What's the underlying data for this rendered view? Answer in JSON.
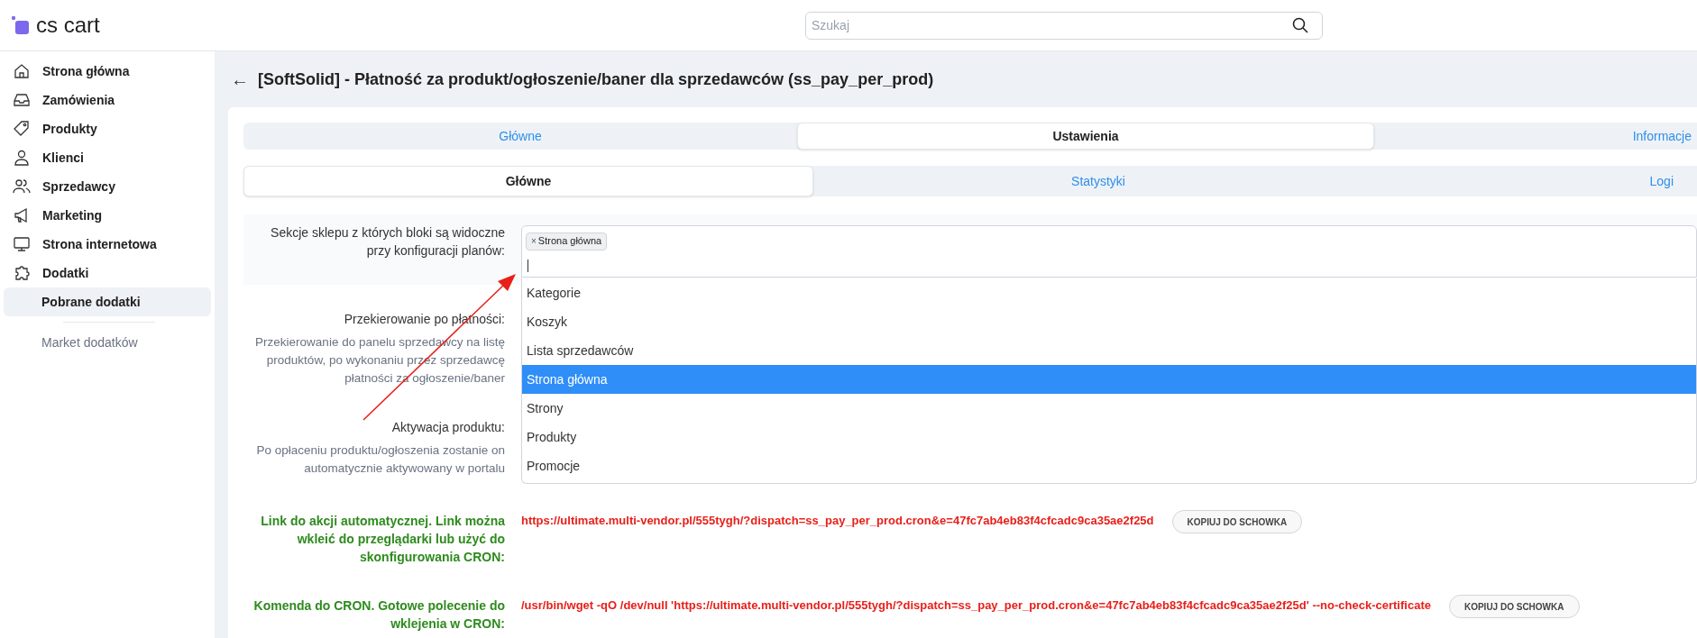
{
  "header": {
    "logo_text": "cs cart",
    "search": {
      "placeholder": "Szukaj"
    }
  },
  "sidebar": {
    "items": [
      {
        "label": "Strona główna",
        "selected": false
      },
      {
        "label": "Zamówienia",
        "selected": false
      },
      {
        "label": "Produkty",
        "selected": false
      },
      {
        "label": "Klienci",
        "selected": false
      },
      {
        "label": "Sprzedawcy",
        "selected": false
      },
      {
        "label": "Marketing",
        "selected": false
      },
      {
        "label": "Strona internetowa",
        "selected": false
      },
      {
        "label": "Dodatki",
        "selected": false,
        "children": [
          {
            "label": "Pobrane dodatki",
            "selected": true
          },
          {
            "label": "Market dodatków",
            "selected": false
          }
        ]
      }
    ]
  },
  "page": {
    "back": "←",
    "title": "[SoftSolid] - Płatność za produkt/ogłoszenie/baner dla sprzedawców (ss_pay_per_prod)"
  },
  "tabs": [
    {
      "label": "Główne",
      "selected": false
    },
    {
      "label": "Ustawienia",
      "selected": true
    },
    {
      "label": "Informacje",
      "selected": false
    }
  ],
  "subtabs": [
    {
      "label": "Główne",
      "selected": true
    },
    {
      "label": "Statystyki",
      "selected": false
    },
    {
      "label": "Logi",
      "selected": false
    }
  ],
  "settings": [
    {
      "label": "Sekcje sklepu z których bloki są widoczne przy konfiguracji planów:"
    },
    {
      "label": "Przekierowanie po płatności:",
      "hint": "Przekierowanie do panelu sprzedawcy na listę produktów, po wykonaniu przez sprzedawcę płatności za ogłoszenie/baner"
    },
    {
      "label": "Aktywacja produktu:",
      "hint": "Po opłaceniu produktu/ogłoszenia zostanie on automatycznie aktywowany w portalu"
    }
  ],
  "multiselect": {
    "tags": [
      {
        "remove": "×",
        "label": "Strona główna"
      }
    ],
    "options": [
      {
        "label": "Kategorie",
        "highlighted": false
      },
      {
        "label": "Koszyk",
        "highlighted": false
      },
      {
        "label": "Lista sprzedawców",
        "highlighted": false
      },
      {
        "label": "Strona główna",
        "highlighted": true
      },
      {
        "label": "Strony",
        "highlighted": false
      },
      {
        "label": "Produkty",
        "highlighted": false
      },
      {
        "label": "Promocje",
        "highlighted": false
      }
    ]
  },
  "cron_rows": [
    {
      "label": "Link do akcji automatycznej. Link można wkleić do przeglądarki lub użyć do skonfigurowania CRON:",
      "value": "https://ultimate.multi-vendor.pl/555tygh/?dispatch=ss_pay_per_prod.cron&e=47fc7ab4eb83f4cfcadc9ca35ae2f25d",
      "button": "KOPIUJ DO SCHOWKA"
    },
    {
      "label": "Komenda do CRON. Gotowe polecenie do wklejenia w CRON:",
      "value": "/usr/bin/wget -qO /dev/null 'https://ultimate.multi-vendor.pl/555tygh/?dispatch=ss_pay_per_prod.cron&e=47fc7ab4eb83f4cfcadc9ca35ae2f25d' --no-check-certificate",
      "button": "KOPIUJ DO SCHOWKA"
    }
  ]
}
